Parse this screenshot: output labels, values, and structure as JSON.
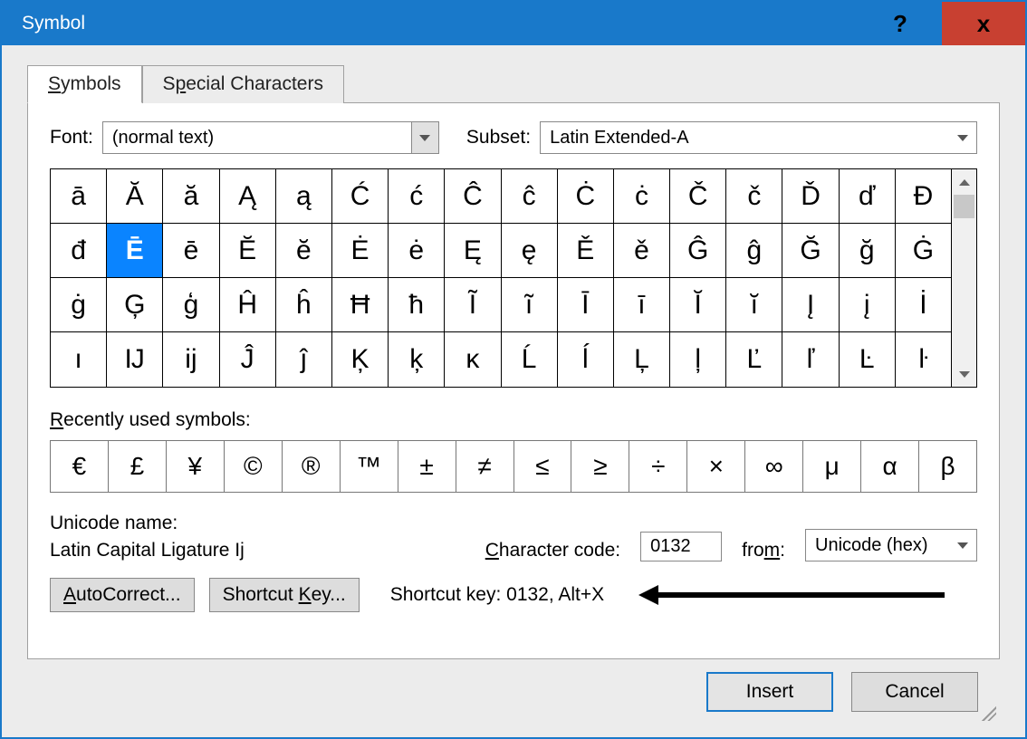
{
  "window": {
    "title": "Symbol"
  },
  "tabs": {
    "symbols": "Symbols",
    "special": "Special Characters"
  },
  "labels": {
    "font": "Font:",
    "subset": "Subset:",
    "recent": "Recently used symbols:",
    "unicode_name": "Unicode name:",
    "char_code": "Character code:",
    "from": "from:",
    "shortcut_prefix": "Shortcut key: "
  },
  "font_value": "(normal text)",
  "subset_value": "Latin Extended-A",
  "char_code_value": "0132",
  "from_value": "Unicode (hex)",
  "unicode_name_value": "Latin Capital Ligature Ij",
  "shortcut_key": "0132, Alt+X",
  "buttons": {
    "autocorrect": "AutoCorrect...",
    "shortcut_key": "Shortcut Key...",
    "insert": "Insert",
    "cancel": "Cancel"
  },
  "selected_index": 17,
  "grid": [
    [
      "ā",
      "Ă",
      "ă",
      "Ą",
      "ą",
      "Ć",
      "ć",
      "Ĉ",
      "ĉ",
      "Ċ",
      "ċ",
      "Č",
      "č",
      "Ď",
      "ď",
      "Đ"
    ],
    [
      "đ",
      "Ē",
      "ē",
      "Ĕ",
      "ĕ",
      "Ė",
      "ė",
      "Ę",
      "ę",
      "Ě",
      "ě",
      "Ĝ",
      "ĝ",
      "Ğ",
      "ğ",
      "Ġ"
    ],
    [
      "ġ",
      "Ģ",
      "ģ",
      "Ĥ",
      "ĥ",
      "Ħ",
      "ħ",
      "Ĩ",
      "ĩ",
      "Ī",
      "ī",
      "Ĭ",
      "ĭ",
      "Į",
      "į",
      "İ"
    ],
    [
      "ı",
      "Ĳ",
      "ĳ",
      "Ĵ",
      "ĵ",
      "Ķ",
      "ķ",
      "ĸ",
      "Ĺ",
      "ĺ",
      "Ļ",
      "ļ",
      "Ľ",
      "ľ",
      "Ŀ",
      "ŀ"
    ]
  ],
  "recent": [
    "€",
    "£",
    "¥",
    "©",
    "®",
    "™",
    "±",
    "≠",
    "≤",
    "≥",
    "÷",
    "×",
    "∞",
    "μ",
    "α",
    "β"
  ]
}
